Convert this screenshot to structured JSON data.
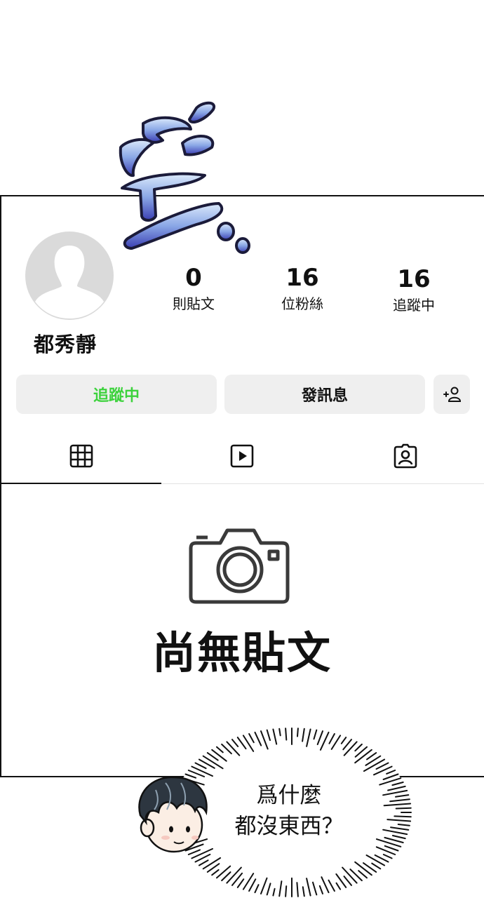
{
  "sfx_text": "空...",
  "profile": {
    "username": "都秀靜",
    "stats": [
      {
        "value": "0",
        "label": "則貼文"
      },
      {
        "value": "16",
        "label": "位粉絲"
      },
      {
        "value": "16",
        "label": "追蹤中"
      }
    ],
    "buttons": {
      "following": "追蹤中",
      "message": "發訊息"
    }
  },
  "tabs": [
    "grid-icon",
    "reels-icon",
    "tagged-icon"
  ],
  "empty_state": {
    "title": "尚無貼文"
  },
  "speech_bubble": {
    "line1": "爲什麼",
    "line2": "都沒東西？"
  },
  "colors": {
    "follow_text": "#3dd23d",
    "button_bg": "#efefef",
    "sfx_top": "#cfe3fb",
    "sfx_bottom": "#3b3fb4"
  }
}
